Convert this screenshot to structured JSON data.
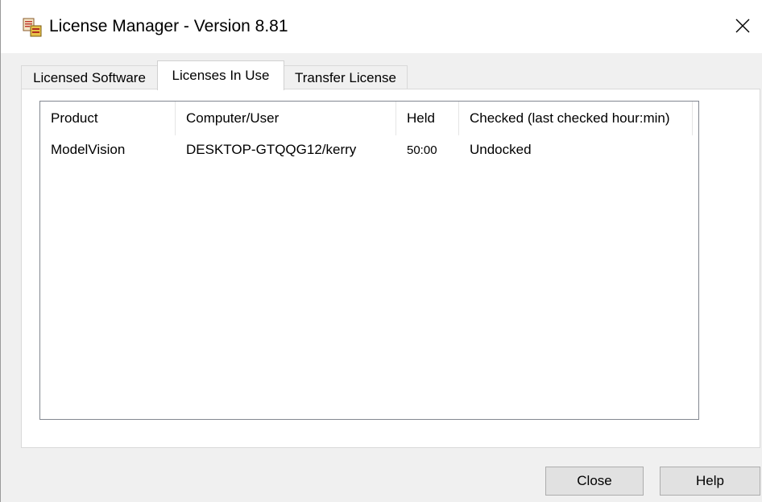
{
  "window": {
    "title": "License Manager - Version 8.81"
  },
  "tabs": [
    {
      "label": "Licensed Software"
    },
    {
      "label": "Licenses In Use"
    },
    {
      "label": "Transfer License"
    }
  ],
  "licenses_table": {
    "columns": [
      "Product",
      "Computer/User",
      "Held",
      "Checked (last checked hour:min)"
    ],
    "rows": [
      {
        "product": "ModelVision",
        "computer_user": "DESKTOP-GTQQG12/kerry",
        "held": "50:00",
        "checked": "Undocked"
      }
    ]
  },
  "buttons": {
    "close": "Close",
    "help": "Help"
  },
  "icons": {
    "app": "license-manager-app-icon",
    "close": "close-icon"
  }
}
